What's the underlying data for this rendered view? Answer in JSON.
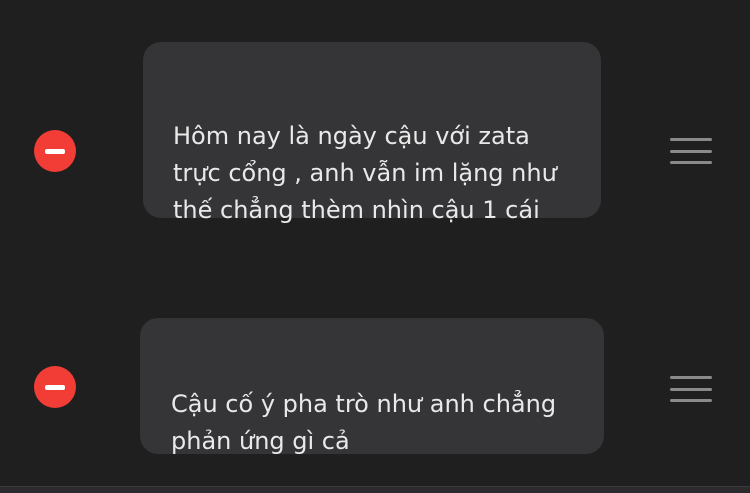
{
  "colors": {
    "background": "#1f1f20",
    "bubble": "#353537",
    "text": "#e9e9ea",
    "delete": "#f23d36",
    "handle": "#8a8a8d"
  },
  "items": [
    {
      "text": "Hôm nay là ngày cậu với zata\ntrực cổng , anh vẫn im lặng như\nthế chẳng thèm nhìn cậu 1 cái",
      "delete_icon": "minus-circle-icon",
      "handle_icon": "reorder-icon"
    },
    {
      "text": "Cậu cố ý pha trò như anh chẳng\nphản ứng gì cả",
      "delete_icon": "minus-circle-icon",
      "handle_icon": "reorder-icon"
    }
  ]
}
